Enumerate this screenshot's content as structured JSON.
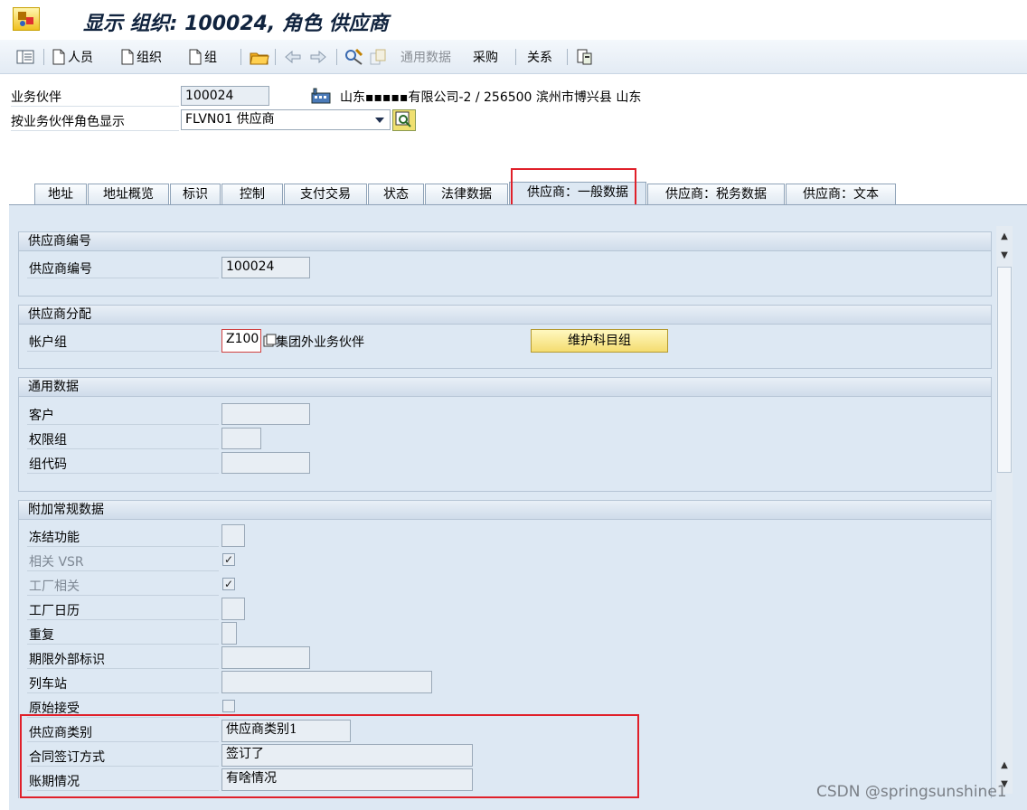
{
  "window": {
    "title": "显示 组织: 100024, 角色 供应商"
  },
  "toolbar": {
    "person": "人员",
    "org": "组织",
    "group": "组",
    "general_data": "通用数据",
    "purchasing": "采购",
    "relationships": "关系"
  },
  "header": {
    "bp_label": "业务伙伴",
    "bp_value": "100024",
    "bp_desc": "山东▪▪▪▪▪有限公司-2 / 256500 滨州市博兴县 山东",
    "role_label": "按业务伙伴角色显示",
    "role_value": "FLVN01 供应商"
  },
  "tabs": [
    {
      "label": "地址"
    },
    {
      "label": "地址概览"
    },
    {
      "label": "标识"
    },
    {
      "label": "控制"
    },
    {
      "label": "支付交易"
    },
    {
      "label": "状态"
    },
    {
      "label": "法律数据"
    },
    {
      "label": "供应商：一般数据"
    },
    {
      "label": "供应商：税务数据"
    },
    {
      "label": "供应商：文本"
    }
  ],
  "groups": {
    "vendor_no": {
      "title": "供应商编号",
      "label": "供应商编号",
      "value": "100024"
    },
    "assignment": {
      "title": "供应商分配",
      "label": "帐户组",
      "value": "Z100",
      "desc": "集团外业务伙伴",
      "button": "维护科目组"
    },
    "general": {
      "title": "通用数据",
      "customer": "客户",
      "auth_group": "权限组",
      "group_code": "组代码"
    },
    "additional": {
      "title": "附加常规数据",
      "freeze": "冻结功能",
      "vsr": "相关 VSR",
      "plant_rel": "工厂相关",
      "factory_cal": "工厂日历",
      "duplicate": "重复",
      "ext_id": "期限外部标识",
      "train_station": "列车站",
      "orig_accept": "原始接受",
      "vendor_type": "供应商类别",
      "vendor_type_value": "供应商类别1",
      "contract_method": "合同签订方式",
      "contract_method_value": "签订了",
      "payment_term": "账期情况",
      "payment_term_value": "有啥情况",
      "check_mark": "✓"
    }
  },
  "watermark": "CSDN @springsunshine1",
  "colors": {
    "accent": "#e0202a",
    "pane_bg": "#dde8f3",
    "title_color": "#10233e"
  }
}
